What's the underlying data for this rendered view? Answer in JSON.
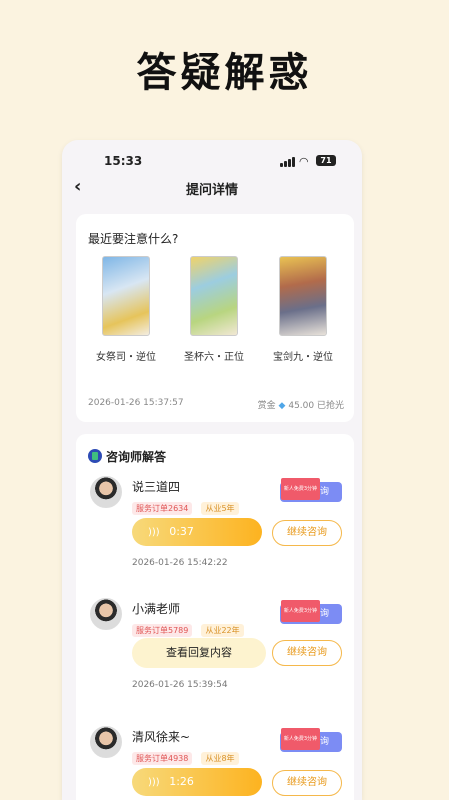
{
  "banner": {
    "title": "答疑解惑"
  },
  "status": {
    "time": "15:33",
    "battery": "71"
  },
  "nav": {
    "back_icon": "chevron-left-icon",
    "title": "提问详情"
  },
  "question": {
    "text": "最近要注意什么?",
    "cards": [
      {
        "name": "女祭司・逆位"
      },
      {
        "name": "圣杯六・正位"
      },
      {
        "name": "宝剑九・逆位"
      }
    ],
    "date": "2026-01-26 15:37:57",
    "reward_label": "赏金",
    "reward_icon": "diamond-icon",
    "reward_value": "45.00",
    "reward_status": "已抢光"
  },
  "answers": {
    "heading": "咨询师解答",
    "voice_label": "语音咨询",
    "voice_tag": "新人免费3分钟",
    "continue_label": "继续咨询",
    "items": [
      {
        "name": "说三道四",
        "orders": "服务订单2634",
        "years": "从业5年",
        "audio": "0:37",
        "time": "2026-01-26 15:42:22"
      },
      {
        "name": "小满老师",
        "orders": "服务订单5789",
        "years": "从业22年",
        "reply": "查看回复内容",
        "time": "2026-01-26 15:39:54"
      },
      {
        "name": "清风徐来~",
        "orders": "服务订单4938",
        "years": "从业8年",
        "audio": "1:26"
      }
    ]
  }
}
